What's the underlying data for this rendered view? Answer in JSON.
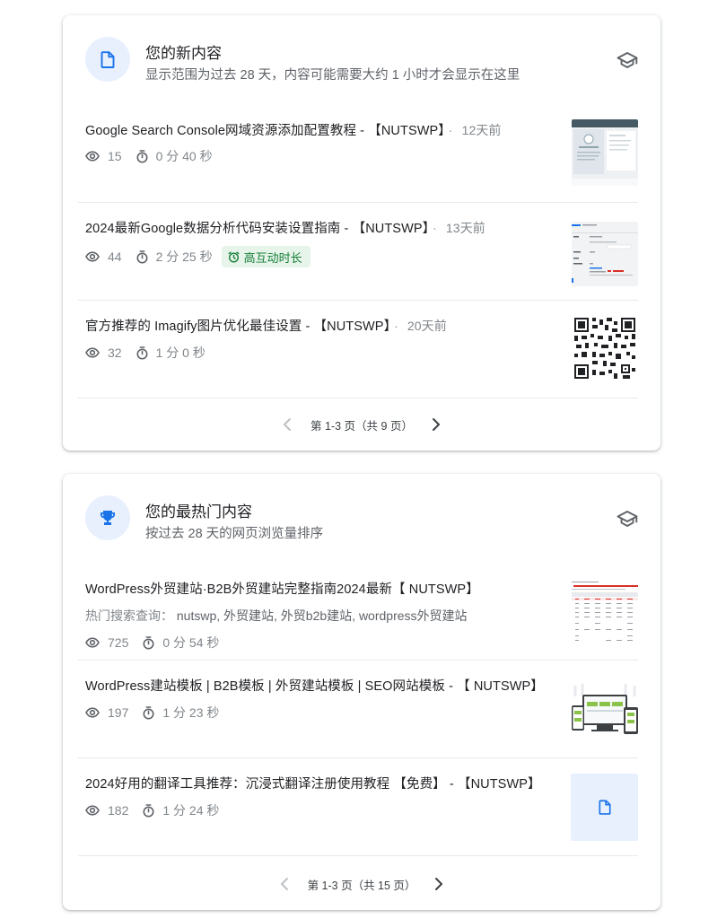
{
  "new_content": {
    "title": "您的新内容",
    "subtitle": "显示范围为过去 28 天，内容可能需要大约 1 小时才会显示在这里",
    "items": [
      {
        "title": "Google Search Console网域资源添加配置教程 - 【NUTSWP】",
        "age": "12天前",
        "views": "15",
        "duration": "0 分 40 秒",
        "thumbnail": "gsc-tutorial-screenshot"
      },
      {
        "title": "2024最新Google数据分析代码安装设置指南 - 【NUTSWP】",
        "age": "13天前",
        "views": "44",
        "duration": "2 分 25 秒",
        "badge": "高互动时长",
        "thumbnail": "ga-setup-screenshot"
      },
      {
        "title": "官方推荐的 Imagify图片优化最佳设置 - 【NUTSWP】",
        "age": "20天前",
        "views": "32",
        "duration": "1 分 0 秒",
        "thumbnail": "qr-code"
      }
    ],
    "pager": "第 1-3 页（共 9 页）"
  },
  "top_content": {
    "title": "您的最热门内容",
    "subtitle": "按过去 28 天的网页浏览量排序",
    "items": [
      {
        "title": "WordPress外贸建站·B2B外贸建站完整指南2024最新【 NUTSWP】",
        "query_label": "热门搜索查询：",
        "queries": "nutswp, 外贸建站, 外贸b2b建站, wordpress外贸建站",
        "views": "725",
        "duration": "0 分 54 秒",
        "thumbnail": "usage-stats-table"
      },
      {
        "title": "WordPress建站模板 | B2B模板 | 外贸建站模板 | SEO网站模板 - 【 NUTSWP】",
        "views": "197",
        "duration": "1 分 23 秒",
        "thumbnail": "template-devices"
      },
      {
        "title": "2024好用的翻译工具推荐：沉浸式翻译注册使用教程 【免费】 - 【NUTSWP】",
        "views": "182",
        "duration": "1 分 24 秒",
        "thumbnail": "document-placeholder-icon"
      }
    ],
    "pager": "第 1-3 页（共 15 页）"
  },
  "colors": {
    "accent_blue": "#1a73e8",
    "badge_green_bg": "#e6f4ea",
    "badge_green_text": "#188038",
    "muted_text": "#80868b"
  }
}
